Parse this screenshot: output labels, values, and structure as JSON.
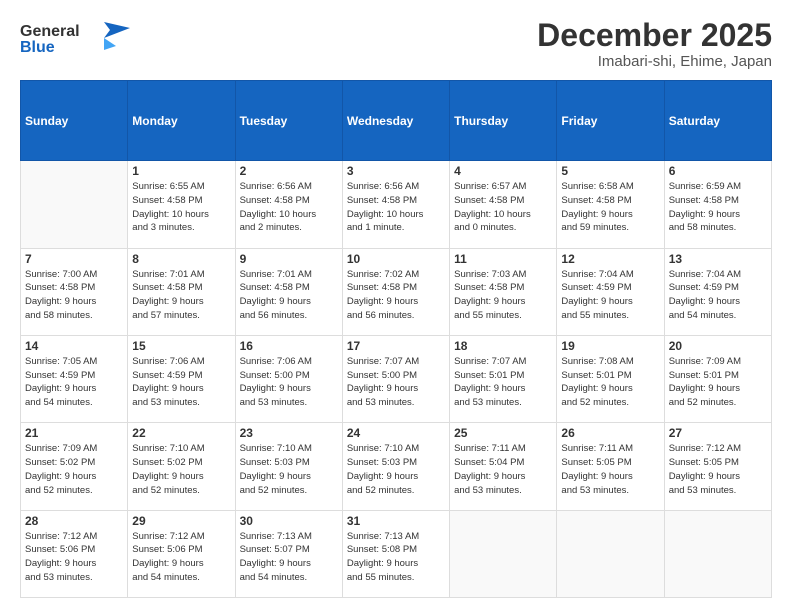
{
  "header": {
    "logo": {
      "line1": "General",
      "line2": "Blue"
    },
    "title": "December 2025",
    "location": "Imabari-shi, Ehime, Japan"
  },
  "days_of_week": [
    "Sunday",
    "Monday",
    "Tuesday",
    "Wednesday",
    "Thursday",
    "Friday",
    "Saturday"
  ],
  "weeks": [
    [
      {
        "day": "",
        "info": ""
      },
      {
        "day": "1",
        "info": "Sunrise: 6:55 AM\nSunset: 4:58 PM\nDaylight: 10 hours\nand 3 minutes."
      },
      {
        "day": "2",
        "info": "Sunrise: 6:56 AM\nSunset: 4:58 PM\nDaylight: 10 hours\nand 2 minutes."
      },
      {
        "day": "3",
        "info": "Sunrise: 6:56 AM\nSunset: 4:58 PM\nDaylight: 10 hours\nand 1 minute."
      },
      {
        "day": "4",
        "info": "Sunrise: 6:57 AM\nSunset: 4:58 PM\nDaylight: 10 hours\nand 0 minutes."
      },
      {
        "day": "5",
        "info": "Sunrise: 6:58 AM\nSunset: 4:58 PM\nDaylight: 9 hours\nand 59 minutes."
      },
      {
        "day": "6",
        "info": "Sunrise: 6:59 AM\nSunset: 4:58 PM\nDaylight: 9 hours\nand 58 minutes."
      }
    ],
    [
      {
        "day": "7",
        "info": "Sunrise: 7:00 AM\nSunset: 4:58 PM\nDaylight: 9 hours\nand 58 minutes."
      },
      {
        "day": "8",
        "info": "Sunrise: 7:01 AM\nSunset: 4:58 PM\nDaylight: 9 hours\nand 57 minutes."
      },
      {
        "day": "9",
        "info": "Sunrise: 7:01 AM\nSunset: 4:58 PM\nDaylight: 9 hours\nand 56 minutes."
      },
      {
        "day": "10",
        "info": "Sunrise: 7:02 AM\nSunset: 4:58 PM\nDaylight: 9 hours\nand 56 minutes."
      },
      {
        "day": "11",
        "info": "Sunrise: 7:03 AM\nSunset: 4:58 PM\nDaylight: 9 hours\nand 55 minutes."
      },
      {
        "day": "12",
        "info": "Sunrise: 7:04 AM\nSunset: 4:59 PM\nDaylight: 9 hours\nand 55 minutes."
      },
      {
        "day": "13",
        "info": "Sunrise: 7:04 AM\nSunset: 4:59 PM\nDaylight: 9 hours\nand 54 minutes."
      }
    ],
    [
      {
        "day": "14",
        "info": "Sunrise: 7:05 AM\nSunset: 4:59 PM\nDaylight: 9 hours\nand 54 minutes."
      },
      {
        "day": "15",
        "info": "Sunrise: 7:06 AM\nSunset: 4:59 PM\nDaylight: 9 hours\nand 53 minutes."
      },
      {
        "day": "16",
        "info": "Sunrise: 7:06 AM\nSunset: 5:00 PM\nDaylight: 9 hours\nand 53 minutes."
      },
      {
        "day": "17",
        "info": "Sunrise: 7:07 AM\nSunset: 5:00 PM\nDaylight: 9 hours\nand 53 minutes."
      },
      {
        "day": "18",
        "info": "Sunrise: 7:07 AM\nSunset: 5:01 PM\nDaylight: 9 hours\nand 53 minutes."
      },
      {
        "day": "19",
        "info": "Sunrise: 7:08 AM\nSunset: 5:01 PM\nDaylight: 9 hours\nand 52 minutes."
      },
      {
        "day": "20",
        "info": "Sunrise: 7:09 AM\nSunset: 5:01 PM\nDaylight: 9 hours\nand 52 minutes."
      }
    ],
    [
      {
        "day": "21",
        "info": "Sunrise: 7:09 AM\nSunset: 5:02 PM\nDaylight: 9 hours\nand 52 minutes."
      },
      {
        "day": "22",
        "info": "Sunrise: 7:10 AM\nSunset: 5:02 PM\nDaylight: 9 hours\nand 52 minutes."
      },
      {
        "day": "23",
        "info": "Sunrise: 7:10 AM\nSunset: 5:03 PM\nDaylight: 9 hours\nand 52 minutes."
      },
      {
        "day": "24",
        "info": "Sunrise: 7:10 AM\nSunset: 5:03 PM\nDaylight: 9 hours\nand 52 minutes."
      },
      {
        "day": "25",
        "info": "Sunrise: 7:11 AM\nSunset: 5:04 PM\nDaylight: 9 hours\nand 53 minutes."
      },
      {
        "day": "26",
        "info": "Sunrise: 7:11 AM\nSunset: 5:05 PM\nDaylight: 9 hours\nand 53 minutes."
      },
      {
        "day": "27",
        "info": "Sunrise: 7:12 AM\nSunset: 5:05 PM\nDaylight: 9 hours\nand 53 minutes."
      }
    ],
    [
      {
        "day": "28",
        "info": "Sunrise: 7:12 AM\nSunset: 5:06 PM\nDaylight: 9 hours\nand 53 minutes."
      },
      {
        "day": "29",
        "info": "Sunrise: 7:12 AM\nSunset: 5:06 PM\nDaylight: 9 hours\nand 54 minutes."
      },
      {
        "day": "30",
        "info": "Sunrise: 7:13 AM\nSunset: 5:07 PM\nDaylight: 9 hours\nand 54 minutes."
      },
      {
        "day": "31",
        "info": "Sunrise: 7:13 AM\nSunset: 5:08 PM\nDaylight: 9 hours\nand 55 minutes."
      },
      {
        "day": "",
        "info": ""
      },
      {
        "day": "",
        "info": ""
      },
      {
        "day": "",
        "info": ""
      }
    ]
  ]
}
